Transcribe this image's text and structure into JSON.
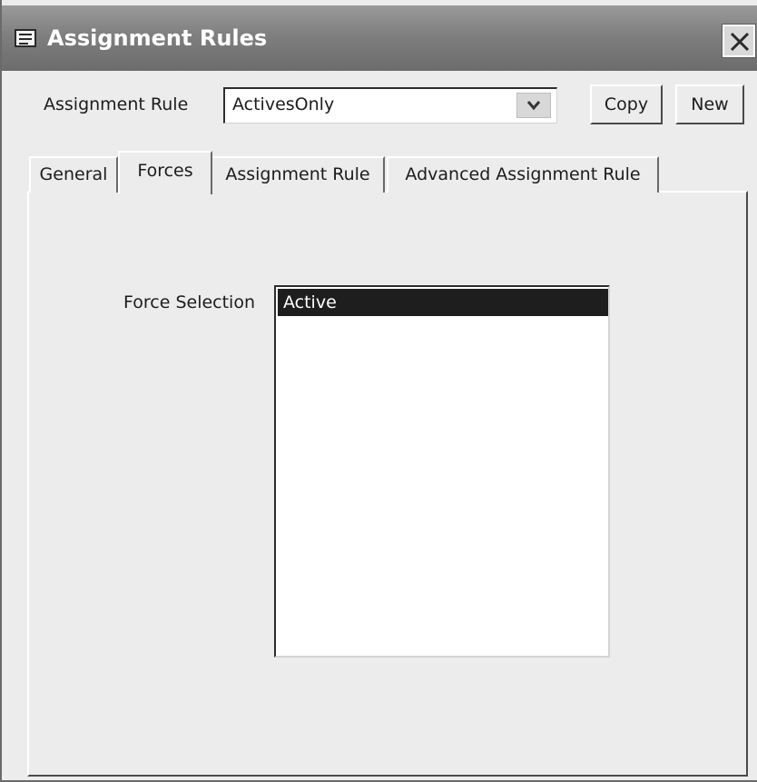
{
  "window": {
    "title": "Assignment Rules",
    "title_icon": "form-icon",
    "close_icon": "close-icon"
  },
  "header": {
    "rule_label": "Assignment Rule",
    "rule_value": "ActivesOnly",
    "dropdown_icon": "chevron-down-icon",
    "copy_label": "Copy",
    "new_label": "New"
  },
  "tabs": [
    {
      "label": "General",
      "active": false
    },
    {
      "label": "Forces",
      "active": true
    },
    {
      "label": "Assignment Rule",
      "active": false
    },
    {
      "label": "Advanced Assignment Rule",
      "active": false
    }
  ],
  "forces": {
    "label": "Force Selection",
    "items": [
      {
        "label": "Active",
        "selected": true
      }
    ]
  },
  "colors": {
    "titlebar": "#7f7f7f",
    "selection": "#1e1e1e",
    "window_bg": "#ececec"
  }
}
